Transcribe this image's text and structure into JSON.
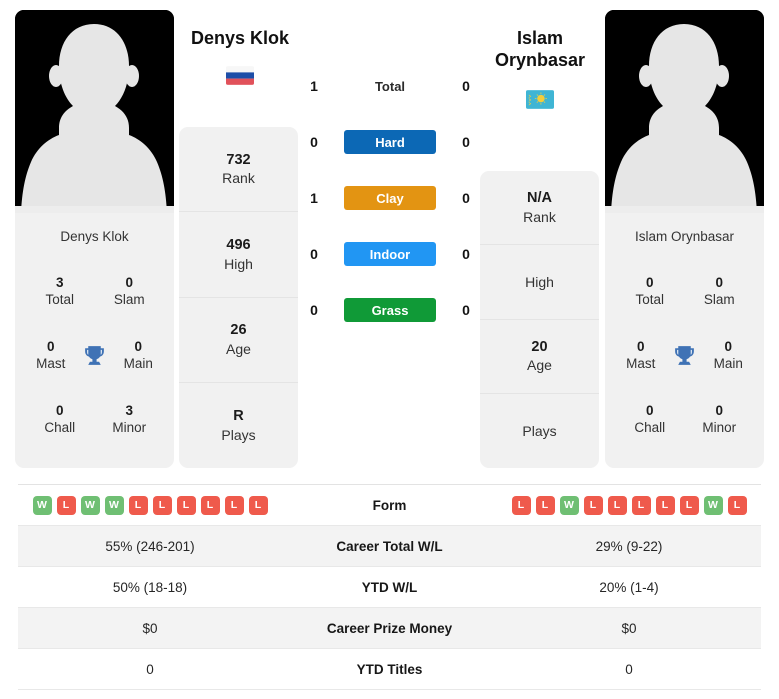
{
  "players": {
    "left": {
      "name": "Denys Klok",
      "card_name": "Denys Klok",
      "flag": "russia-flag",
      "rank": "732",
      "rank_label": "Rank",
      "high": "496",
      "high_label": "High",
      "age": "26",
      "age_label": "Age",
      "plays": "R",
      "plays_label": "Plays",
      "titles": {
        "total": "3",
        "total_label": "Total",
        "slam": "0",
        "slam_label": "Slam",
        "mast": "0",
        "mast_label": "Mast",
        "main": "0",
        "main_label": "Main",
        "chall": "0",
        "chall_label": "Chall",
        "minor": "3",
        "minor_label": "Minor"
      },
      "form": [
        "W",
        "L",
        "W",
        "W",
        "L",
        "L",
        "L",
        "L",
        "L",
        "L"
      ],
      "career_total_wl": "55% (246-201)",
      "ytd_wl": "50% (18-18)",
      "career_prize_money": "$0",
      "ytd_titles": "0"
    },
    "right": {
      "name": "Islam Orynbasar",
      "card_name": "Islam Orynbasar",
      "flag": "kazakhstan-flag",
      "rank": "N/A",
      "rank_label": "Rank",
      "high": "",
      "high_label": "High",
      "age": "20",
      "age_label": "Age",
      "plays": "",
      "plays_label": "Plays",
      "titles": {
        "total": "0",
        "total_label": "Total",
        "slam": "0",
        "slam_label": "Slam",
        "mast": "0",
        "mast_label": "Mast",
        "main": "0",
        "main_label": "Main",
        "chall": "0",
        "chall_label": "Chall",
        "minor": "0",
        "minor_label": "Minor"
      },
      "form": [
        "L",
        "L",
        "W",
        "L",
        "L",
        "L",
        "L",
        "L",
        "W",
        "L"
      ],
      "career_total_wl": "29% (9-22)",
      "ytd_wl": "20% (1-4)",
      "career_prize_money": "$0",
      "ytd_titles": "0"
    }
  },
  "h2h": {
    "rows": [
      {
        "label": "Total",
        "left": "1",
        "right": "0",
        "type": "label",
        "color": ""
      },
      {
        "label": "Hard",
        "left": "0",
        "right": "0",
        "type": "badge",
        "color": "#0c68b5"
      },
      {
        "label": "Clay",
        "left": "1",
        "right": "0",
        "type": "badge",
        "color": "#e39412"
      },
      {
        "label": "Indoor",
        "left": "0",
        "right": "0",
        "type": "badge",
        "color": "#2196f3"
      },
      {
        "label": "Grass",
        "left": "0",
        "right": "0",
        "type": "badge",
        "color": "#109a37"
      }
    ]
  },
  "stats_table": {
    "rows": [
      {
        "label": "Form",
        "left": "",
        "right": "",
        "type": "form"
      },
      {
        "label": "Career Total W/L",
        "left": "55% (246-201)",
        "right": "29% (9-22)",
        "type": "text"
      },
      {
        "label": "YTD W/L",
        "left": "50% (18-18)",
        "right": "20% (1-4)",
        "type": "text"
      },
      {
        "label": "Career Prize Money",
        "left": "$0",
        "right": "$0",
        "type": "text"
      },
      {
        "label": "YTD Titles",
        "left": "0",
        "right": "0",
        "type": "text"
      }
    ]
  },
  "colors": {
    "hard": "#0c68b5",
    "clay": "#e39412",
    "indoor": "#2196f3",
    "grass": "#109a37",
    "win": "#6fbf73",
    "loss": "#ef5a4c",
    "trophy": "#3f72b5",
    "card_bg": "#f1f1f1"
  }
}
